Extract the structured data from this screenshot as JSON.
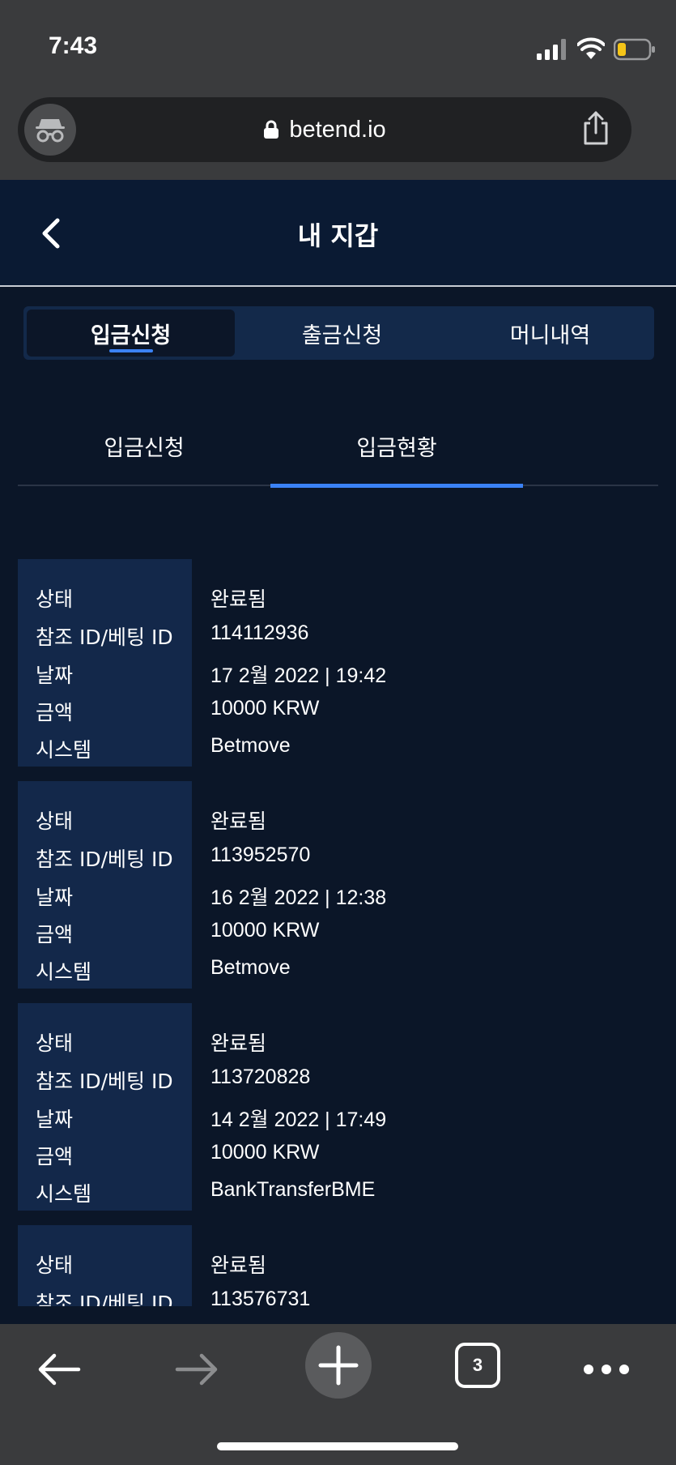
{
  "status_bar": {
    "time": "7:43"
  },
  "browser": {
    "url": "betend.io",
    "tab_count": "3",
    "icons": [
      "incognito-icon",
      "lock-icon",
      "share-icon",
      "back-arrow-icon",
      "forward-arrow-icon",
      "plus-icon",
      "tabs-icon",
      "more-icon"
    ]
  },
  "header": {
    "title": "내 지갑"
  },
  "main_tabs": [
    {
      "label": "입금신청",
      "active": true
    },
    {
      "label": "출금신청",
      "active": false
    },
    {
      "label": "머니내역",
      "active": false
    }
  ],
  "sub_tabs": [
    {
      "label": "입금신청",
      "active": false
    },
    {
      "label": "입금현황",
      "active": true
    }
  ],
  "labels": {
    "status": "상태",
    "ref_id": "참조 ID/베팅 ID",
    "date": "날짜",
    "amount": "금액",
    "system": "시스템"
  },
  "records": [
    {
      "status": "완료됨",
      "ref_id": "114112936",
      "date": "17 2월 2022 | 19:42",
      "amount": "10000 KRW",
      "system": "Betmove"
    },
    {
      "status": "완료됨",
      "ref_id": "113952570",
      "date": "16 2월 2022 | 12:38",
      "amount": "10000 KRW",
      "system": "Betmove"
    },
    {
      "status": "완료됨",
      "ref_id": "113720828",
      "date": "14 2월 2022 | 17:49",
      "amount": "10000 KRW",
      "system": "BankTransferBME"
    },
    {
      "status": "완료됨",
      "ref_id": "113576731"
    }
  ],
  "colors": {
    "page_bg": "#0b1628",
    "label_cell_bg": "#13284a",
    "accent": "#3b82f6",
    "browser_chrome": "#3a3b3d"
  }
}
